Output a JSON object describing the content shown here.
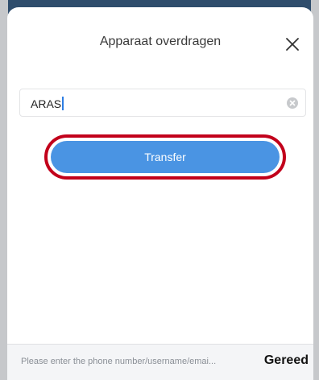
{
  "modal": {
    "title": "Apparaat overdragen",
    "close_icon": "close-icon"
  },
  "search": {
    "value": "ARAS",
    "clear_icon": "clear-icon"
  },
  "actions": {
    "transfer_label": "Transfer"
  },
  "bottom_bar": {
    "placeholder": "Please enter the phone number/username/emai...",
    "done_label": "Gereed"
  },
  "colors": {
    "accent": "#4a94e3",
    "highlight": "#c2001b"
  }
}
